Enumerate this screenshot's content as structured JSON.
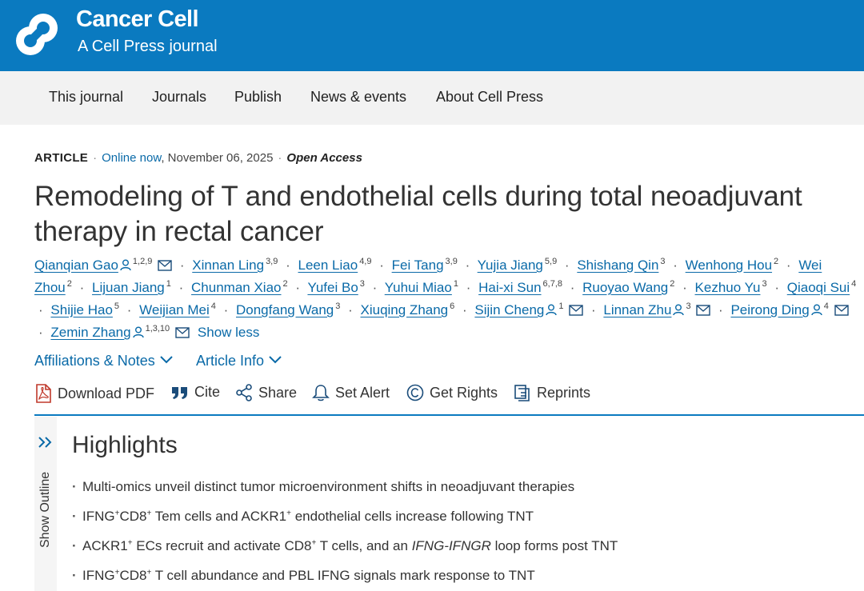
{
  "header": {
    "title": "Cancer Cell",
    "subtitle": "A Cell Press journal",
    "bg_color": "#0a7ac0"
  },
  "nav": {
    "items": [
      "This journal",
      "Journals",
      "Publish",
      "News & events",
      "About Cell Press"
    ]
  },
  "meta": {
    "type": "ARTICLE",
    "online_label": "Online now",
    "date": ", November 06, 2025",
    "access": "Open Access"
  },
  "article": {
    "title": "Remodeling of T and endothelial cells during total neoadjuvant therapy in rectal cancer"
  },
  "authors": [
    {
      "name": "Qianqian Gao",
      "sup": "1,2,9",
      "person": true,
      "mail": true
    },
    {
      "name": "Xinnan Ling",
      "sup": "3,9"
    },
    {
      "name": "Leen Liao",
      "sup": "4,9"
    },
    {
      "name": "Fei Tang",
      "sup": "3,9"
    },
    {
      "name": "Yujia Jiang",
      "sup": "5,9"
    },
    {
      "name": "Shishang Qin",
      "sup": "3"
    },
    {
      "name": "Wenhong Hou",
      "sup": "2"
    },
    {
      "name": "Wei Zhou",
      "sup": "2"
    },
    {
      "name": "Lijuan Jiang",
      "sup": "1"
    },
    {
      "name": "Chunman Xiao",
      "sup": "2"
    },
    {
      "name": "Yufei Bo",
      "sup": "3"
    },
    {
      "name": "Yuhui Miao",
      "sup": "1"
    },
    {
      "name": "Hai-xi Sun",
      "sup": "6,7,8"
    },
    {
      "name": "Ruoyao Wang",
      "sup": "2"
    },
    {
      "name": "Kezhuo Yu",
      "sup": "3"
    },
    {
      "name": "Qiaoqi Sui",
      "sup": "4"
    },
    {
      "name": "Shijie Hao",
      "sup": "5"
    },
    {
      "name": "Weijian Mei",
      "sup": "4"
    },
    {
      "name": "Dongfang Wang",
      "sup": "3"
    },
    {
      "name": "Xiuqing Zhang",
      "sup": "6"
    },
    {
      "name": "Sijin Cheng",
      "sup": "1",
      "person": true,
      "mail": true
    },
    {
      "name": "Linnan Zhu",
      "sup": "3",
      "person": true,
      "mail": true
    },
    {
      "name": "Peirong Ding",
      "sup": "4",
      "person": true,
      "mail": true
    },
    {
      "name": "Zemin Zhang",
      "sup": "1,3,10",
      "person": true,
      "mail": true
    }
  ],
  "authors_toggle": "Show less",
  "expanders": {
    "affiliations": "Affiliations & Notes",
    "article_info": "Article Info"
  },
  "toolbar": {
    "download_pdf": "Download PDF",
    "cite": "Cite",
    "share": "Share",
    "set_alert": "Set Alert",
    "get_rights": "Get Rights",
    "reprints": "Reprints"
  },
  "outline": {
    "label": "Show Outline"
  },
  "highlights": {
    "title": "Highlights",
    "items": [
      "Multi-omics unveil distinct tumor microenvironment shifts in neoadjuvant therapies",
      "IFNG+CD8+ Tem cells and ACKR1+ endothelial cells increase following TNT",
      "ACKR1+ ECs recruit and activate CD8+ T cells, and an IFNG-IFNGR loop forms post TNT",
      "IFNG+CD8+ T cell abundance and PBL IFNG signals mark response to TNT"
    ]
  },
  "icons": {
    "logo": "cell-press-logo",
    "pdf": "pdf-icon",
    "cite": "quote-icon",
    "share": "share-icon",
    "alert": "bell-icon",
    "rights": "copyright-icon",
    "reprints": "reprints-icon"
  }
}
